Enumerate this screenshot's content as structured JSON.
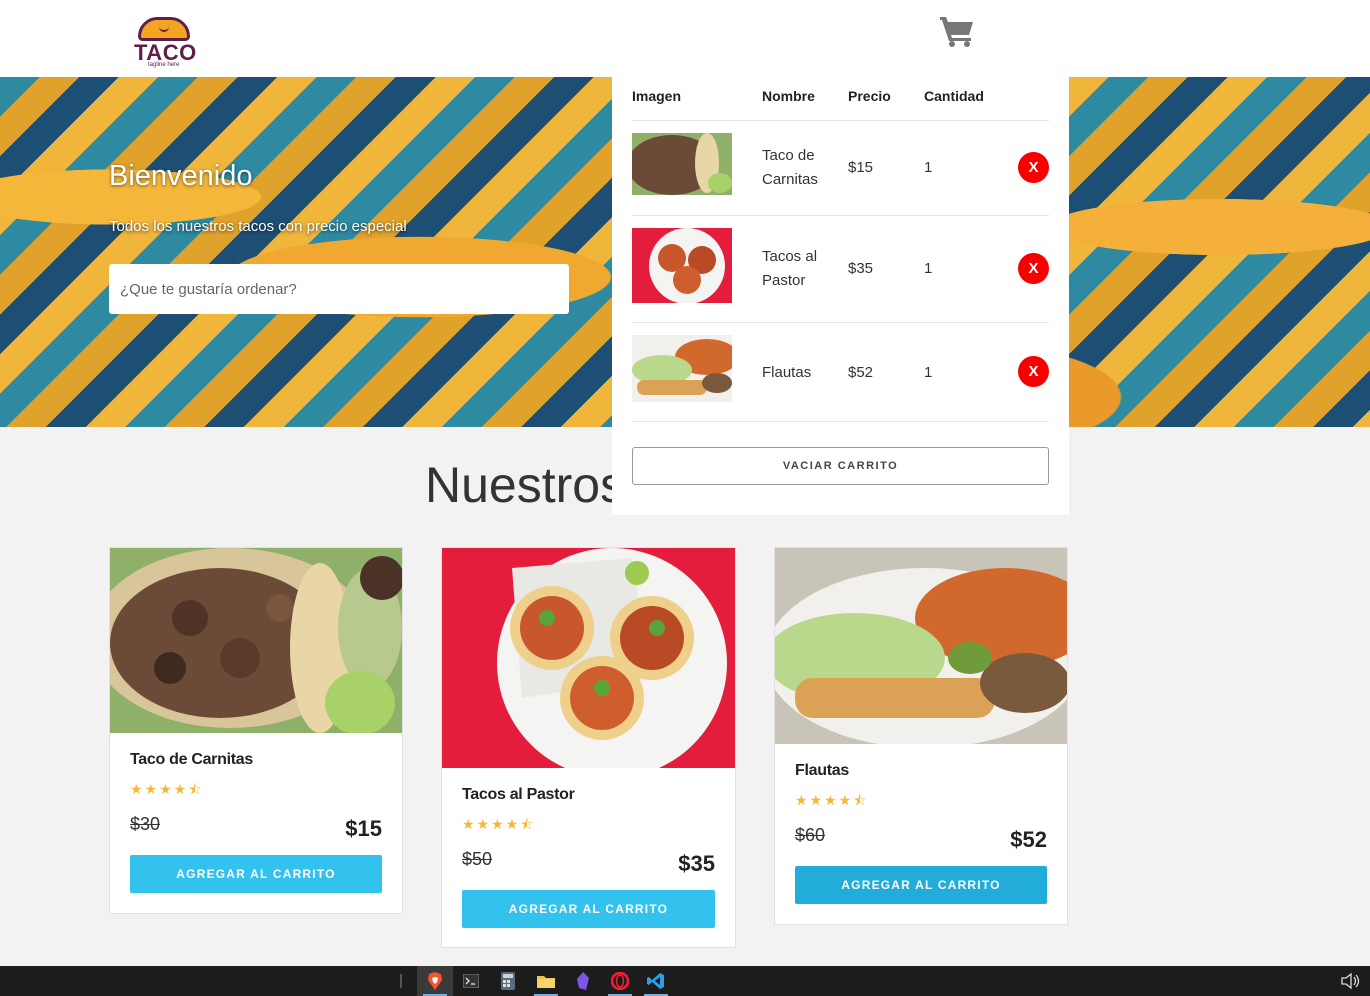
{
  "header": {
    "logo_text": "TACO",
    "logo_tagline": "tagline here",
    "cart_icon": "cart-icon"
  },
  "hero": {
    "title": "Bienvenido",
    "subtitle": "Todos los nuestros tacos con precio especial",
    "search_placeholder": "¿Que te gustaría ordenar?",
    "search_icon": "search-icon",
    "colors": {
      "search_icon": "#e0443a"
    }
  },
  "section": {
    "title": "Nuestros"
  },
  "products": [
    {
      "name": "Taco de Carnitas",
      "rating": 4.5,
      "stars": "★★★★⯪",
      "old_price": "$30",
      "price": "$15",
      "button": "AGREGAR AL CARRITO"
    },
    {
      "name": "Tacos al Pastor",
      "rating": 4.5,
      "stars": "★★★★⯪",
      "old_price": "$50",
      "price": "$35",
      "button": "AGREGAR AL CARRITO"
    },
    {
      "name": "Flautas",
      "rating": 4.5,
      "stars": "★★★★⯪",
      "old_price": "$60",
      "price": "$52",
      "button": "AGREGAR AL CARRITO"
    }
  ],
  "cart": {
    "headers": {
      "image": "Imagen",
      "name": "Nombre",
      "price": "Precio",
      "quantity": "Cantidad"
    },
    "items": [
      {
        "name": "Taco de Carnitas",
        "price": "$15",
        "qty": "1",
        "remove": "X"
      },
      {
        "name": "Tacos al Pastor",
        "price": "$35",
        "qty": "1",
        "remove": "X"
      },
      {
        "name": "Flautas",
        "price": "$52",
        "qty": "1",
        "remove": "X"
      }
    ],
    "empty_button": "VACIAR CARRITO"
  },
  "colors": {
    "accent_button": "#33c1ee",
    "remove": "#f80000",
    "stars": "#f6b73c",
    "logo": "#5d1f4a"
  },
  "taskbar": {
    "apps": [
      "brave-icon",
      "terminal-icon",
      "calculator-icon",
      "file-explorer-icon",
      "obsidian-icon",
      "opera-icon",
      "vscode-icon"
    ],
    "tray": [
      "volume-icon"
    ]
  }
}
